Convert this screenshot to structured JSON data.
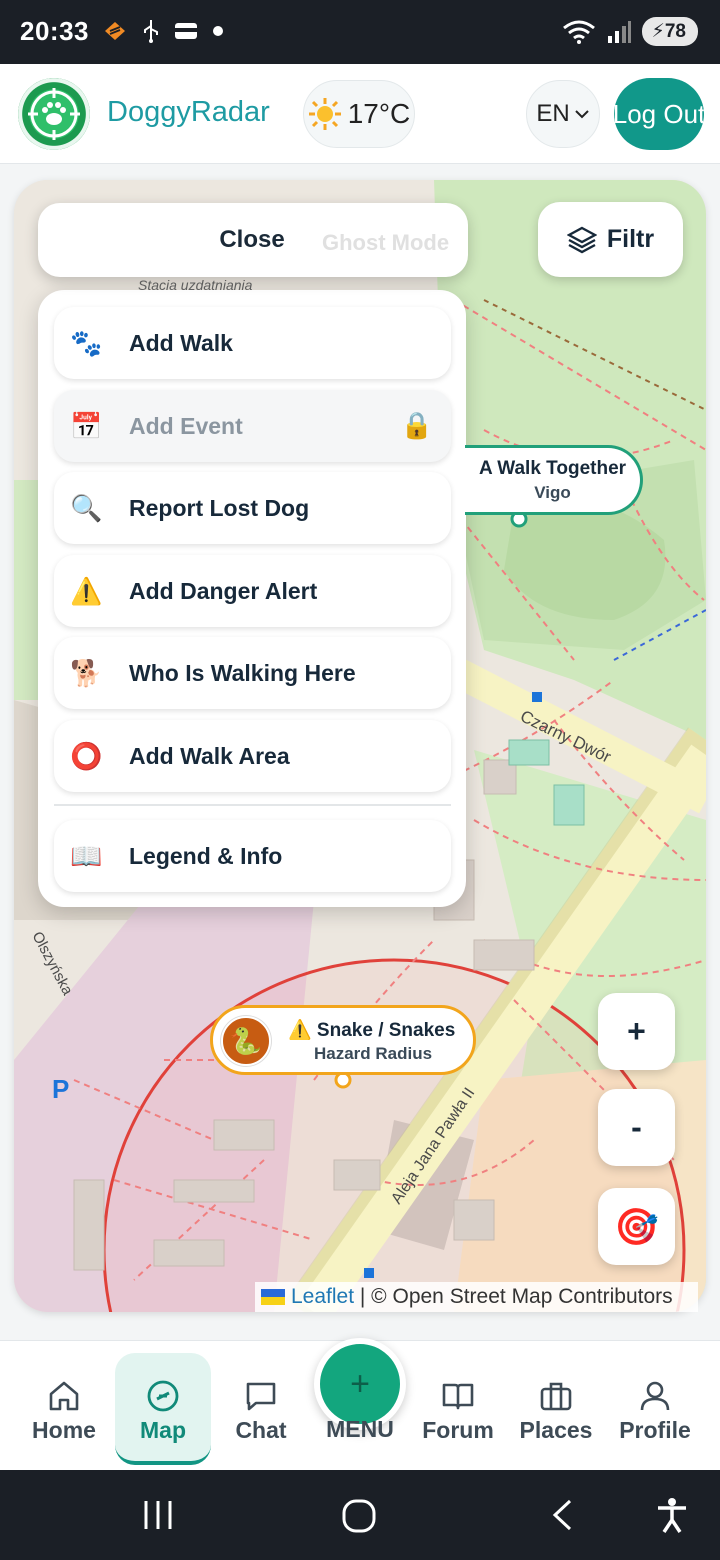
{
  "status_bar": {
    "time": "20:33",
    "battery": "78",
    "icons": [
      "heart-badge-icon",
      "usb-icon",
      "wallet-icon",
      "dot-icon",
      "wifi-icon",
      "signal-icon",
      "battery-icon"
    ]
  },
  "header": {
    "app_name": "DoggyRadar",
    "temperature": "17°C",
    "language": "EN",
    "logout_label": "Log Out"
  },
  "map": {
    "close_label": "Close",
    "ghost_mode_label": "Ghost Mode",
    "filter_label": "Filtr",
    "menu_items": [
      {
        "icon": "🐾",
        "label": "Add Walk",
        "locked": false
      },
      {
        "icon": "📅",
        "label": "Add Event",
        "locked": true
      },
      {
        "icon": "🔍",
        "label": "Report Lost Dog",
        "locked": false
      },
      {
        "icon": "⚠️",
        "label": "Add Danger Alert",
        "locked": false
      },
      {
        "icon": "🐕",
        "label": "Who Is Walking Here",
        "locked": false
      },
      {
        "icon": "⭕",
        "label": "Add Walk Area",
        "locked": false
      },
      {
        "icon": "📖",
        "label": "Legend & Info",
        "locked": false
      }
    ],
    "walk_marker": {
      "title": "A Walk Together",
      "subtitle": "Vigo"
    },
    "hazard_marker": {
      "title": "⚠️ Snake / Snakes",
      "subtitle": "Hazard Radius"
    },
    "zoom_in": "+",
    "zoom_out": "-",
    "locate_icon": "🎯",
    "street_labels": [
      "Czarny Dwór",
      "Aleja Jana Pawła II",
      "Olszyńska",
      "Stacja uzdatniania",
      "P"
    ],
    "attribution": {
      "leaflet": "Leaflet",
      "rest": " | © Open Street Map Contributors"
    }
  },
  "bottom_nav": {
    "items": [
      {
        "label": "Home",
        "icon": "home-icon",
        "active": false
      },
      {
        "label": "Map",
        "icon": "compass-icon",
        "active": true
      },
      {
        "label": "Chat",
        "icon": "chat-icon",
        "active": false
      },
      {
        "label": "Forum",
        "icon": "book-icon",
        "active": false
      },
      {
        "label": "Places",
        "icon": "briefcase-icon",
        "active": false
      },
      {
        "label": "Profile",
        "icon": "person-icon",
        "active": false
      }
    ],
    "menu_label": "MENU",
    "menu_icon": "+"
  }
}
